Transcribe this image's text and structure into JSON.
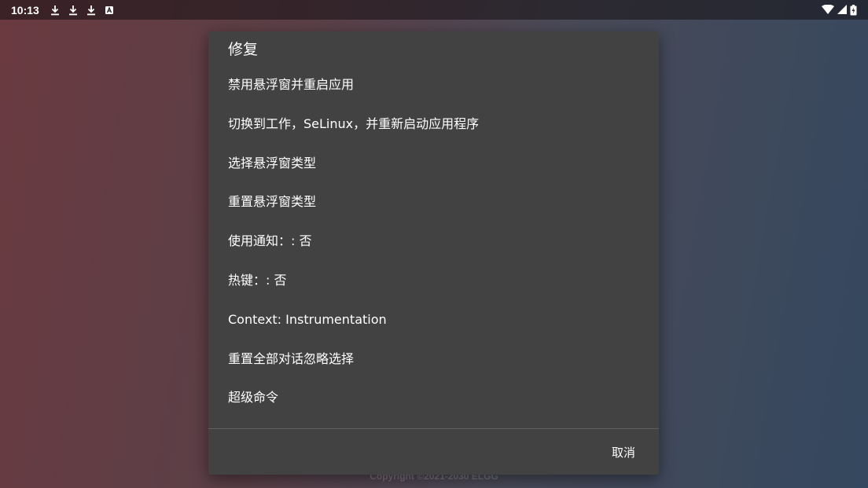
{
  "status_bar": {
    "time": "10:13",
    "icons": [
      "download-icon",
      "download-icon",
      "download-icon",
      "app-icon"
    ],
    "right_icons": [
      "wifi-icon",
      "signal-icon",
      "battery-icon"
    ]
  },
  "background": {
    "copyright": "Copyright ©2021-2030 ELGG"
  },
  "dialog": {
    "title": "修复",
    "items": [
      {
        "label": "禁用悬浮窗并重启应用"
      },
      {
        "label": "切换到工作，SeLinux，并重新启动应用程序"
      },
      {
        "label": "选择悬浮窗类型"
      },
      {
        "label": "重置悬浮窗类型"
      },
      {
        "label": "使用通知：: 否"
      },
      {
        "label": "热键：: 否"
      },
      {
        "label": "Context: Instrumentation"
      },
      {
        "label": "重置全部对话忽略选择"
      },
      {
        "label": "超级命令"
      }
    ],
    "cancel_label": "取消"
  }
}
